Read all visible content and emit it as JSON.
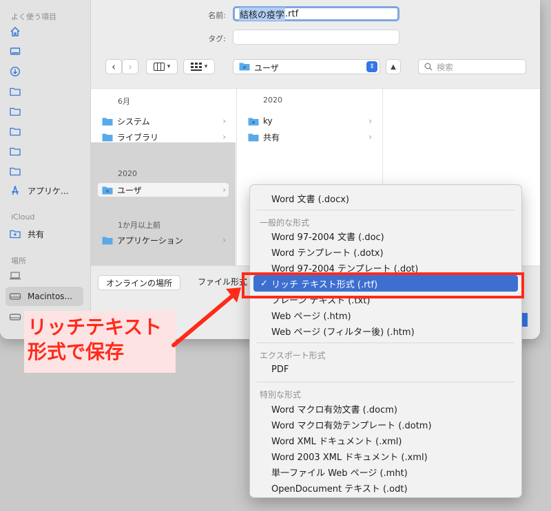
{
  "sidebar": {
    "favorites_header": "よく使う項目",
    "items": [
      {
        "icon": "home-icon",
        "label": ""
      },
      {
        "icon": "desktop-icon",
        "label": ""
      },
      {
        "icon": "download-icon",
        "label": ""
      },
      {
        "icon": "folder-icon",
        "label": ""
      },
      {
        "icon": "folder-icon",
        "label": ""
      },
      {
        "icon": "folder-icon",
        "label": ""
      },
      {
        "icon": "folder-icon",
        "label": ""
      },
      {
        "icon": "folder-icon",
        "label": ""
      },
      {
        "icon": "applications-icon",
        "label": "アプリケ..."
      }
    ],
    "icloud_header": "iCloud",
    "icloud_items": [
      {
        "icon": "shared-folder-icon",
        "label": "共有"
      }
    ],
    "locations_header": "場所",
    "location_items": [
      {
        "icon": "laptop-icon",
        "label": ""
      },
      {
        "icon": "disk-icon",
        "label": "Macintos..."
      },
      {
        "icon": "disk-icon",
        "label": ""
      }
    ]
  },
  "form": {
    "name_label": "名前:",
    "name_selected": "結核の疫学",
    "name_ext": ".rtf",
    "tag_label": "タグ:",
    "tag_value": ""
  },
  "toolbar": {
    "back": "‹",
    "forward": "›",
    "location": "ユーザ",
    "search_placeholder": "検索"
  },
  "browser": {
    "col1_header1": "6月",
    "col1_items1": [
      "システム",
      "ライブラリ"
    ],
    "col1_header2": "2020",
    "col1_items2": [
      "ユーザ"
    ],
    "col1_header3": "1か月以上前",
    "col1_items3": [
      "アプリケーション"
    ],
    "col2_header": "2020",
    "col2_items": [
      "ky",
      "共有"
    ]
  },
  "bottom": {
    "online_button": "オンラインの場所",
    "format_label": "ファイル形式"
  },
  "menu": {
    "top_item": "Word 文書 (.docx)",
    "common_header": "一般的な形式",
    "common_items": [
      "Word 97-2004 文書 (.doc)",
      "Word テンプレート (.dotx)",
      "Word 97-2004 テンプレート (.dot)",
      "リッチ テキスト形式 (.rtf)",
      "プレーン テキスト (.txt)",
      "Web ページ (.htm)",
      "Web ページ (フィルター後) (.htm)"
    ],
    "export_header": "エクスポート形式",
    "export_items": [
      "PDF"
    ],
    "special_header": "特別な形式",
    "special_items": [
      "Word マクロ有効文書 (.docm)",
      "Word マクロ有効テンプレート (.dotm)",
      "Word XML ドキュメント (.xml)",
      "Word 2003 XML ドキュメント (.xml)",
      "単一ファイル Web ページ (.mht)",
      "OpenDocument テキスト (.odt)"
    ],
    "checkmark": "✓"
  },
  "annotation": {
    "line1": "リッチテキスト",
    "line2": "形式で保存",
    "color": "#ff2a1a"
  },
  "colors": {
    "accent": "#3477e6",
    "menu_selection": "#3d6fd1",
    "folder": "#5aa9e8"
  }
}
